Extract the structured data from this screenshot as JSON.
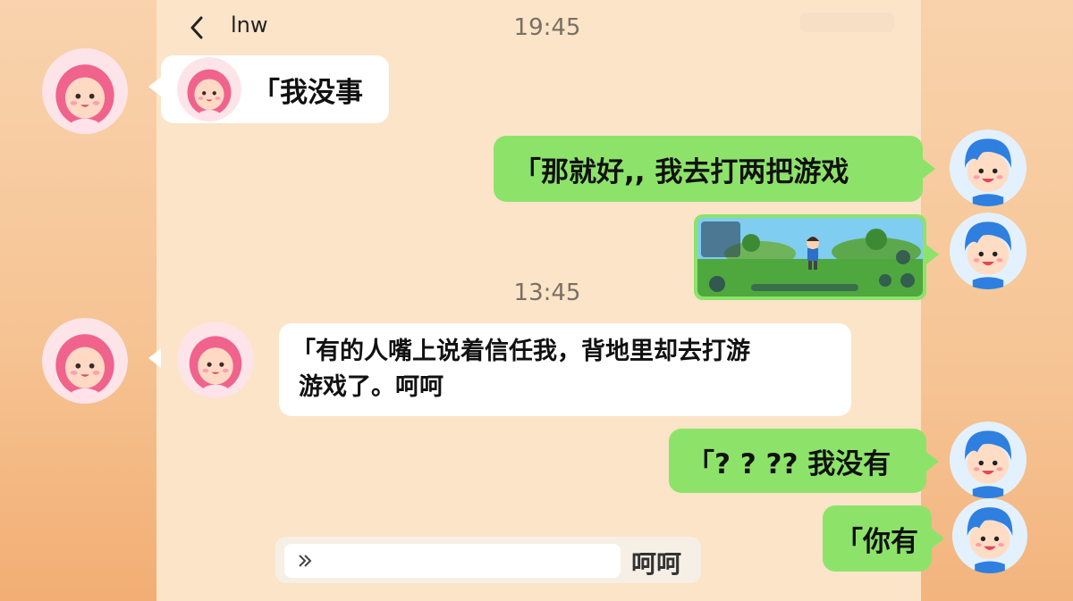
{
  "header": {
    "title": "lnw",
    "back_icon": "chevron-left-icon"
  },
  "timestamps": [
    "19:45",
    "13:45"
  ],
  "messages": [
    {
      "side": "left",
      "text": "「我没事",
      "sticker": "girl-avatar-sticker"
    },
    {
      "side": "right",
      "text": "「那就好,,  我去打两把游戏"
    },
    {
      "side": "right",
      "image": "game-screenshot"
    },
    {
      "side": "left",
      "text_line1": "「有的人嘴上说着信任我，背地里却去打游",
      "text_line2": "游戏了。呵呵",
      "sticker": "girl-avatar-sticker"
    },
    {
      "side": "right",
      "text": "「? ? ?? 我没有"
    },
    {
      "side": "right",
      "text": "「你有"
    }
  ],
  "input": {
    "prefix_icon": "double-chevron-right-icon",
    "value": "",
    "send_label": "呵呵"
  },
  "colors": {
    "bubble_green": "#8de36a",
    "bubble_white": "#ffffff",
    "panel_bg": "#fbe4c8",
    "girl_accent": "#f0638c",
    "boy_accent": "#2f7fe0"
  }
}
